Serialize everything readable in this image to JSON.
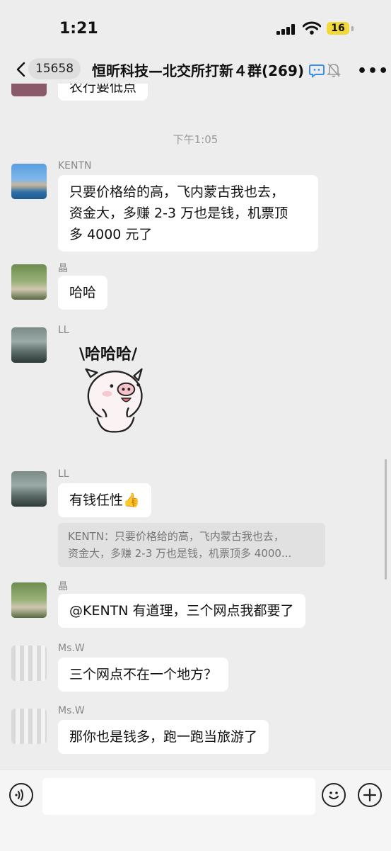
{
  "status_bar": {
    "time": "1:21",
    "battery": "16"
  },
  "header": {
    "unread_count": "15658",
    "title": "恒昕科技—北交所打新４群(269)"
  },
  "messages": [
    {
      "type": "partial",
      "text": "农行要低点"
    },
    {
      "type": "time",
      "text": "下午1:05"
    },
    {
      "type": "text",
      "sender": "KENTN",
      "lines": [
        "只要价格给的高，飞内蒙古我也去，",
        "资金大，多赚 2-3 万也是钱，机票顶",
        "多 4000 元了"
      ]
    },
    {
      "type": "text",
      "sender": "晶",
      "text": "哈哈"
    },
    {
      "type": "sticker",
      "sender": "LL",
      "sticker_text": "\\哈哈哈/"
    },
    {
      "type": "text_quote",
      "sender": "LL",
      "text": "有钱任性👍",
      "quote_lines": [
        "KENTN：只要价格给的高，飞内蒙古我也去，",
        "资金大，多赚 2-3 万也是钱，机票顶多 4000..."
      ]
    },
    {
      "type": "text",
      "sender": "晶",
      "text": "@KENTN 有道理，三个网点我都要了"
    },
    {
      "type": "text",
      "sender": "Ms.W",
      "text": "三个网点不在一个地方？"
    },
    {
      "type": "text",
      "sender": "Ms.W",
      "text": "那你也是钱多，跑一跑当旅游了"
    }
  ],
  "input_bar": {
    "placeholder": ""
  },
  "colors": {
    "background": "#ededed",
    "bubble": "#ffffff",
    "quote": "#e1e1e1",
    "battery": "#f2d93b"
  },
  "icons": [
    "back-icon",
    "chat-ai-icon",
    "mute-bell-icon",
    "more-icon",
    "voice-icon",
    "emoji-icon",
    "plus-icon",
    "thumbs-up-icon"
  ]
}
